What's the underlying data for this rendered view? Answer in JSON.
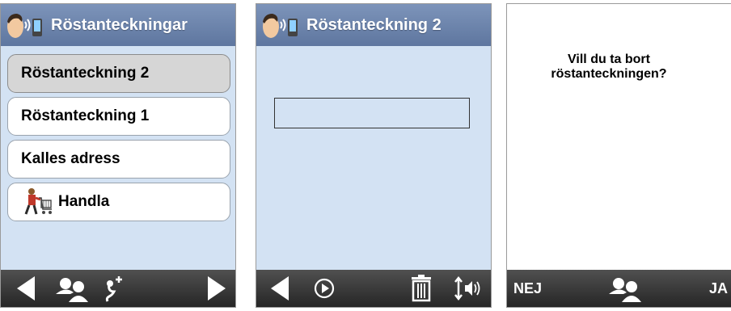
{
  "screen1": {
    "title": "Röstanteckningar",
    "items": [
      {
        "label": "Röstanteckning 2",
        "selected": true
      },
      {
        "label": "Röstanteckning 1",
        "selected": false
      },
      {
        "label": "Kalles adress",
        "selected": false
      },
      {
        "label": "Handla",
        "selected": false,
        "icon": "shopping-cart-person-icon"
      }
    ],
    "bottom_icons": [
      "arrow-left-icon",
      "contacts-icon",
      "microphone-add-icon",
      "arrow-right-icon"
    ]
  },
  "screen2": {
    "title": "Röstanteckning 2",
    "text_box_value": "",
    "bottom_icons": [
      "arrow-left-icon",
      "play-icon",
      "trash-icon",
      "volume-icon"
    ]
  },
  "screen3": {
    "dialog_line1": "Vill du ta bort",
    "dialog_line2": "röstanteckningen?",
    "no_label": "NEJ",
    "yes_label": "JA",
    "bottom_icons": [
      "contacts-icon"
    ]
  },
  "colors": {
    "titlebar": "#6a82aa",
    "background": "#d3e2f3",
    "bottombar": "#333333",
    "selected_item": "#d6d6d6"
  }
}
